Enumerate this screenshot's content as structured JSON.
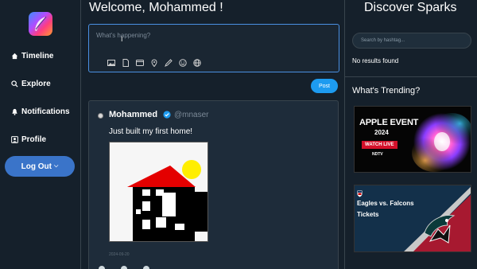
{
  "sidebar": {
    "logo_icon": "quill-feather-icon",
    "items": [
      {
        "label": "Timeline",
        "icon": "home-icon"
      },
      {
        "label": "Explore",
        "icon": "search-icon"
      },
      {
        "label": "Notifications",
        "icon": "bell-icon"
      },
      {
        "label": "Profile",
        "icon": "person-icon"
      }
    ],
    "logout_label": "Log Out"
  },
  "main": {
    "welcome": "Welcome, Mohammed !",
    "compose": {
      "placeholder": "What's happening?",
      "tools": [
        "image-icon",
        "file-icon",
        "gif-icon",
        "location-icon",
        "pen-icon",
        "emoji-icon",
        "globe-icon"
      ]
    },
    "post_button_label": "Post",
    "post": {
      "author": "Mohammed",
      "handle": "@mnaser",
      "text": "Just built my first home!",
      "date": "2024-09-20",
      "image_icon": "house-drawing"
    }
  },
  "right": {
    "title": "Discover Sparks",
    "search_placeholder": "Search by hashtag...",
    "no_results": "No results found",
    "trending_title": "What's Trending?",
    "trends": [
      {
        "title": "APPLE EVENT",
        "year": "2024",
        "badge": "WATCH LIVE",
        "source": "NDTV"
      },
      {
        "title": "Eagles vs. Falcons",
        "subtitle": "Tickets"
      }
    ]
  },
  "colors": {
    "background": "#15202b",
    "accent": "#1d9bf0",
    "logout": "#3a74c9",
    "border": "#38444d"
  }
}
